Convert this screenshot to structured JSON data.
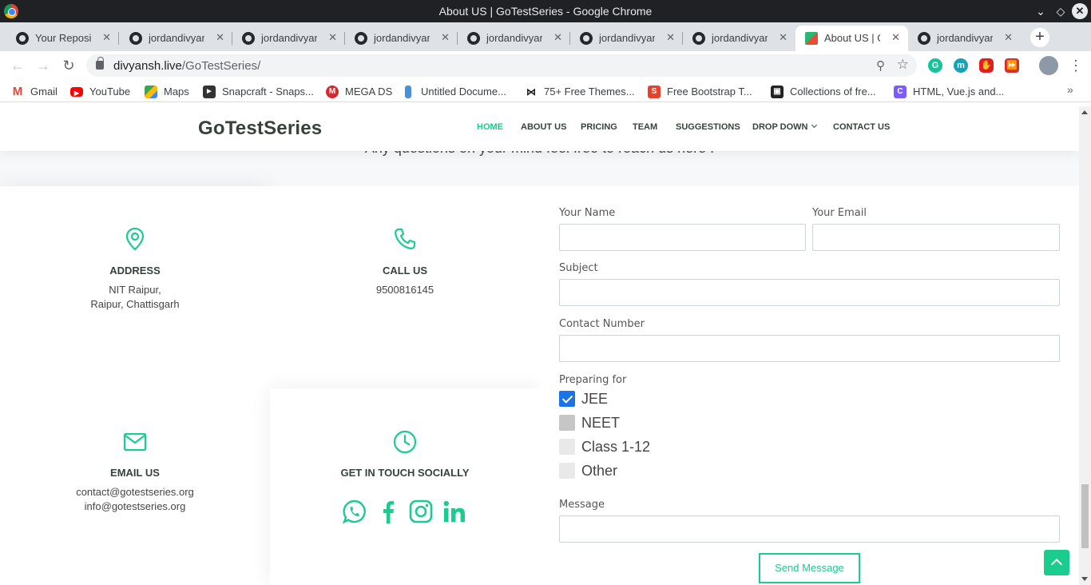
{
  "window": {
    "title": "About US | GoTestSeries - Google Chrome"
  },
  "tabs": [
    {
      "label": "Your Reposit",
      "active": false
    },
    {
      "label": "jordandivyansh",
      "active": false
    },
    {
      "label": "jordandivyansh",
      "active": false
    },
    {
      "label": "jordandivyansh",
      "active": false
    },
    {
      "label": "jordandivyansh",
      "active": false
    },
    {
      "label": "jordandivyansh",
      "active": false
    },
    {
      "label": "jordandivyansh",
      "active": false
    },
    {
      "label": "About US | GoTestSeries",
      "active": true
    },
    {
      "label": "jordandivyansh",
      "active": false
    }
  ],
  "address_bar": {
    "host": "divyansh.live",
    "path": "/GoTestSeries/"
  },
  "bookmarks": [
    {
      "label": "Gmail",
      "icon": "gmail-icon",
      "color": "#ea4335"
    },
    {
      "label": "YouTube",
      "icon": "youtube-icon",
      "color": "#ff0000"
    },
    {
      "label": "Maps",
      "icon": "maps-icon",
      "color": "#34a853"
    },
    {
      "label": "Snapcraft - Snaps...",
      "icon": "snapcraft-icon",
      "color": "#333333"
    },
    {
      "label": "MEGA DS",
      "icon": "mega-icon",
      "color": "#d9272e"
    },
    {
      "label": "Untitled Docume...",
      "icon": "doc-icon",
      "color": "#4a90d9"
    },
    {
      "label": "75+ Free Themes...",
      "icon": "bow-icon",
      "color": "#222222"
    },
    {
      "label": "Free Bootstrap T...",
      "icon": "s-icon",
      "color": "#e5412d"
    },
    {
      "label": "Collections of fre...",
      "icon": "collection-icon",
      "color": "#222222"
    },
    {
      "label": "HTML, Vue.js and...",
      "icon": "c-icon",
      "color": "#7b5cff"
    }
  ],
  "site": {
    "brand": "GoTestSeries",
    "accent_color": "#1acc8d",
    "nav": [
      {
        "label": "HOME",
        "active": true
      },
      {
        "label": "ABOUT US"
      },
      {
        "label": "PRICING"
      },
      {
        "label": "TEAM"
      },
      {
        "label": "SUGGESTIONS"
      },
      {
        "label": "DROP DOWN"
      },
      {
        "label": "CONTACT US"
      }
    ],
    "section_subtitle": "Any questions on your mind feel free to reach us here !"
  },
  "contact": {
    "address": {
      "title": "ADDRESS",
      "line1": "NIT Raipur,",
      "line2": "Raipur, Chattisgarh"
    },
    "call": {
      "title": "CALL US",
      "line1": "9500816145"
    },
    "email": {
      "title": "EMAIL US",
      "line1": "contact@gotestseries.org",
      "line2": "info@gotestseries.org"
    },
    "social": {
      "title": "GET IN TOUCH SOCIALLY",
      "icons": [
        "whatsapp-icon",
        "facebook-icon",
        "instagram-icon",
        "linkedin-icon"
      ]
    }
  },
  "form": {
    "name_label": "Your Name",
    "email_label": "Your Email",
    "subject_label": "Subject",
    "contact_label": "Contact Number",
    "preparing_label": "Preparing for",
    "options": [
      {
        "label": "JEE",
        "checked": true
      },
      {
        "label": "NEET",
        "checked": false
      },
      {
        "label": "Class 1-12",
        "checked": false
      },
      {
        "label": "Other",
        "checked": false
      }
    ],
    "message_label": "Message",
    "submit_label": "Send Message"
  }
}
